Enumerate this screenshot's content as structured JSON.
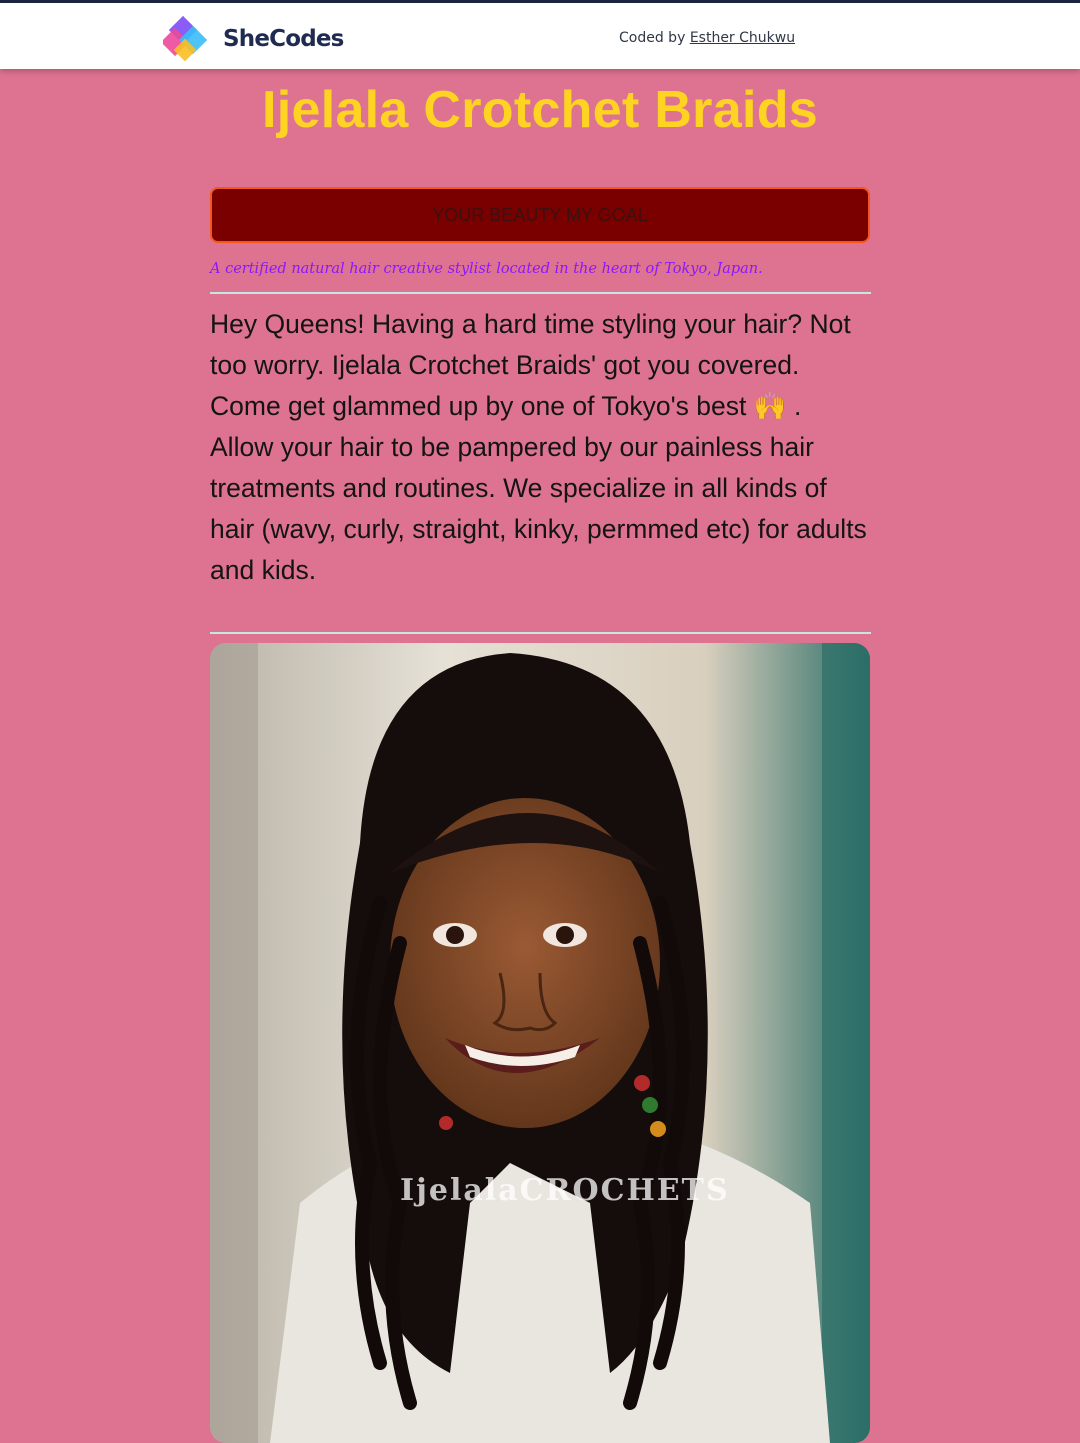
{
  "header": {
    "logo_text": "SheCodes",
    "credit_prefix": "Coded by",
    "credit_author": "Esther Chukwu"
  },
  "main": {
    "title": "Ijelala Crotchet Braids",
    "motto": "YOUR BEAUTY MY GOAL",
    "tagline": "A certified natural hair creative stylist located in the heart of Tokyo, Japan.",
    "intro": "Hey Queens! Having a hard time styling your hair? Not too worry. Ijelala Crotchet Braids' got you covered. Come get glammed up by one of Tokyo's best 🙌 . Allow your hair to be pampered by our painless hair treatments and routines. We specialize in all kinds of hair (wavy, curly, straight, kinky, permmed etc) for adults and kids.",
    "photo_watermark": "IjelalaCROCHETS"
  },
  "colors": {
    "page_bg": "#de7391",
    "title": "#ffd322",
    "motto_bg": "#7a0000",
    "motto_border": "#f2571e",
    "tagline": "#8a18ff",
    "divider": "#c4e7e4"
  }
}
